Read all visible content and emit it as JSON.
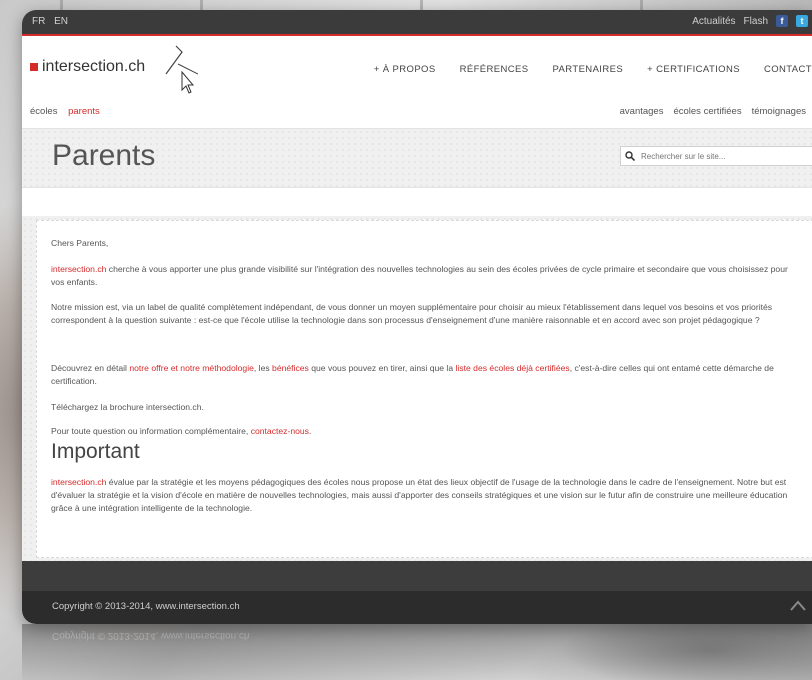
{
  "topbar": {
    "languages": [
      "FR",
      "EN"
    ],
    "links": [
      "Actualités",
      "Flash"
    ],
    "social_icons": [
      "facebook-icon",
      "twitter-icon"
    ]
  },
  "header": {
    "logo_text": "intersection.ch",
    "nav": [
      "+ À PROPOS",
      "RÉFÉRENCES",
      "PARTENAIRES",
      "+ CERTIFICATIONS",
      "CONTACT"
    ]
  },
  "subnav": {
    "left": [
      "écoles",
      "parents"
    ],
    "right": [
      "avantages",
      "écoles certifiées",
      "témoignages"
    ]
  },
  "page": {
    "title": "Parents",
    "search_placeholder": "Rechercher sur le site..."
  },
  "content": {
    "greeting": "Chers Parents,",
    "p1_brand": "intersection.ch",
    "p1_text": " cherche à vous apporter une plus grande visibilité sur l'intégration des nouvelles technologies au sein des écoles privées de cycle primaire et secondaire que vous choisissez pour vos enfants.",
    "p2_text": "Notre mission est, via un label de qualité complètement indépendant, de vous donner un moyen supplémentaire pour choisir au mieux l'établissement dans lequel vos besoins et vos priorités correspondent à la question suivante : est-ce que l'école utilise la technologie dans son processus d'enseignement d'une manière raisonnable et en accord avec son projet pédagogique ?",
    "p3_pre": "Découvrez en détail ",
    "p3_link1": "notre offre et notre méthodologie",
    "p3_mid1": ", les ",
    "p3_link2": "bénéfices",
    "p3_mid2": " que vous pouvez en tirer, ainsi que la ",
    "p3_link3": "liste des écoles déjà certifiées",
    "p3_post": ", c'est-à-dire celles qui ont entamé cette démarche de certification.",
    "p4_text": "Téléchargez la brochure intersection.ch.",
    "p5_pre": "Pour toute question ou information complémentaire, ",
    "p5_link": "contactez-nous",
    "p5_post": ".",
    "important_heading": "Important",
    "p6_brand": "intersection.ch",
    "p6_text": " évalue par la stratégie et les moyens pédagogiques des écoles nous propose un état des lieux objectif de l'usage de la technologie dans le cadre de l'enseignement. Notre but est d'évaluer la stratégie et la vision d'école en matière de nouvelles technologies, mais aussi d'apporter des conseils stratégiques et une vision sur le futur afin de construire une meilleure éducation grâce à une intégration intelligente de la technologie."
  },
  "footer": {
    "copyright": "Copyright © 2013-2014, www.intersection.ch"
  },
  "colors": {
    "accent": "#d62b2b",
    "topbar": "#3b3b3b",
    "footer": "#2c2c2c"
  }
}
